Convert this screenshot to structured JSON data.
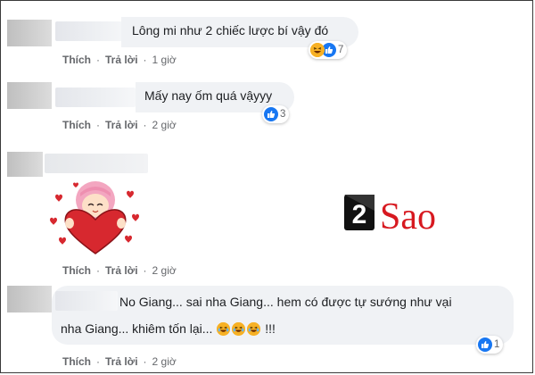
{
  "comments": [
    {
      "text_lines": [
        "Lông mi như 2 chiếc lược bí vậy đó"
      ],
      "like_label": "Thích",
      "reply_label": "Trả lời",
      "time": "1 giờ",
      "reaction_count": "7",
      "reactions": [
        "haha-icon",
        "like-icon"
      ]
    },
    {
      "text_lines": [
        "Mấy nay ốm quá vậyyy"
      ],
      "like_label": "Thích",
      "reply_label": "Trả lời",
      "time": "2 giờ",
      "reaction_count": "3",
      "reactions": [
        "like-icon"
      ]
    },
    {
      "sticker": "girl-hugging-heart-sticker",
      "like_label": "Thích",
      "reply_label": "Trả lời",
      "time": "2 giờ"
    },
    {
      "text_line1": "No Giang... sai nha Giang... hem có được tự sướng như vại",
      "text_line2_prefix": "nha Giang... khiêm tốn lại...",
      "text_line2_suffix": " !!!",
      "inline_emojis": [
        "laughing-emoji",
        "laughing-emoji",
        "laughing-emoji"
      ],
      "like_label": "Thích",
      "reply_label": "Trả lời",
      "time": "2 giờ",
      "reaction_count": "1",
      "reactions": [
        "like-icon"
      ]
    }
  ],
  "watermark": {
    "number": "2",
    "text": "Sao",
    "color": "#d71920"
  },
  "colors": {
    "bubble": "#f0f2f5",
    "like_blue": "#1877f2",
    "action_gray": "#65676b"
  }
}
